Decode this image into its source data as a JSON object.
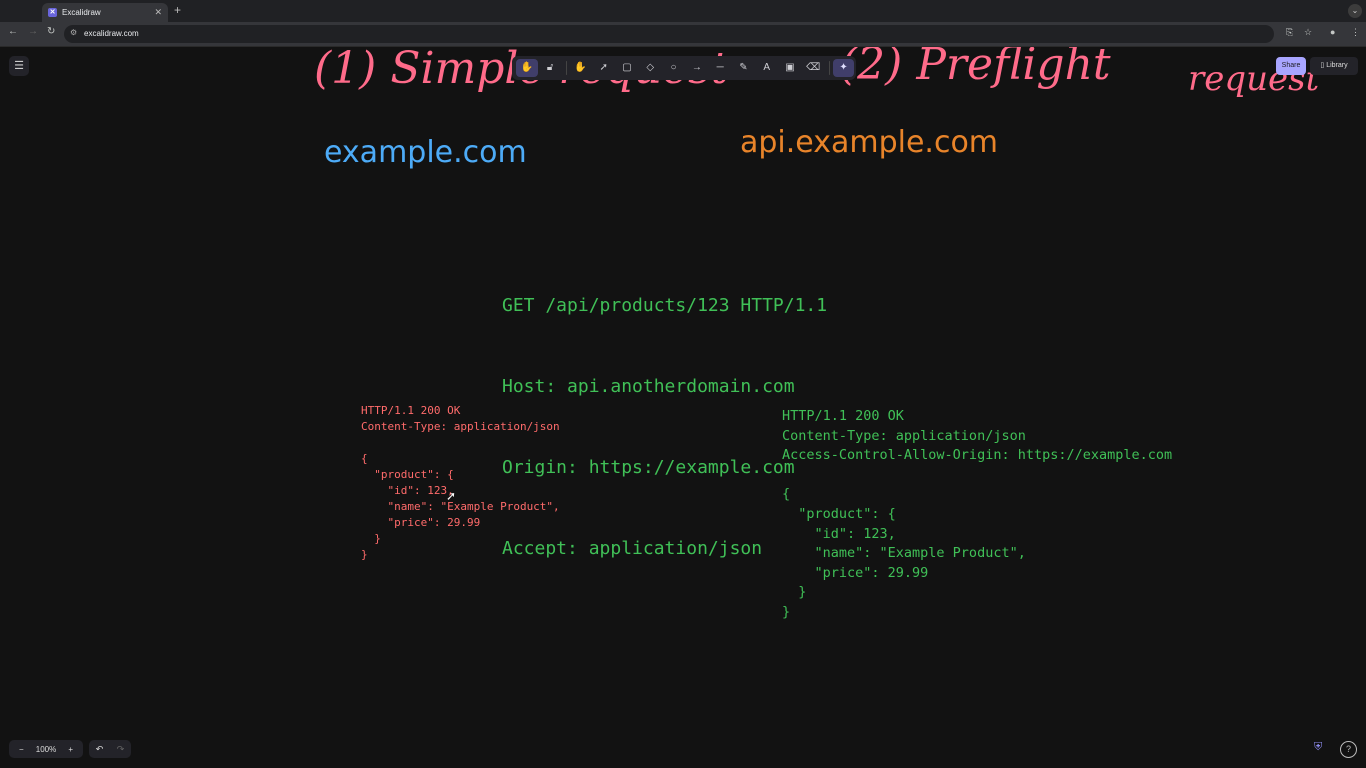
{
  "browser": {
    "tab_title": "Excalidraw",
    "tab_favicon": "excalidraw-logo",
    "new_tab": "+",
    "url": "excalidraw.com"
  },
  "toolbar": {
    "share_label": "Share",
    "library_label": "Library",
    "tools": [
      "hand-lock",
      "lock",
      "hand",
      "selection",
      "rectangle",
      "diamond",
      "ellipse",
      "arrow",
      "line",
      "draw",
      "text",
      "image",
      "eraser",
      "ai"
    ]
  },
  "canvas": {
    "scribbles": [
      {
        "text": "(1) Simple request",
        "color": "#ff6b8a"
      },
      {
        "text": "(2) Preflight",
        "color": "#ff6b8a"
      },
      {
        "text": "request",
        "color": "#ff6b8a"
      }
    ],
    "origin_domain": "example.com",
    "api_domain": "api.example.com",
    "request_lines": [
      "GET /api/products/123 HTTP/1.1",
      "Host: api.anotherdomain.com",
      "Origin: https://example.com",
      "Accept: application/json"
    ],
    "response_left": "HTTP/1.1 200 OK\nContent-Type: application/json\n\n{\n  \"product\": {\n    \"id\": 123,\n    \"name\": \"Example Product\",\n    \"price\": 29.99\n  }\n}",
    "response_right": "HTTP/1.1 200 OK\nContent-Type: application/json\nAccess-Control-Allow-Origin: https://example.com\n\n{\n  \"product\": {\n    \"id\": 123,\n    \"name\": \"Example Product\",\n    \"price\": 29.99\n  }\n}"
  },
  "footer": {
    "zoom_out": "−",
    "zoom_level": "100%",
    "zoom_in": "+",
    "undo": "↶",
    "redo": "↷"
  },
  "colors": {
    "scribble": "#ff6b8a",
    "origin": "#4dabf7",
    "api": "#e8842a",
    "green": "#40c057",
    "red": "#ff6b6b",
    "accent": "#a8a5ff"
  }
}
